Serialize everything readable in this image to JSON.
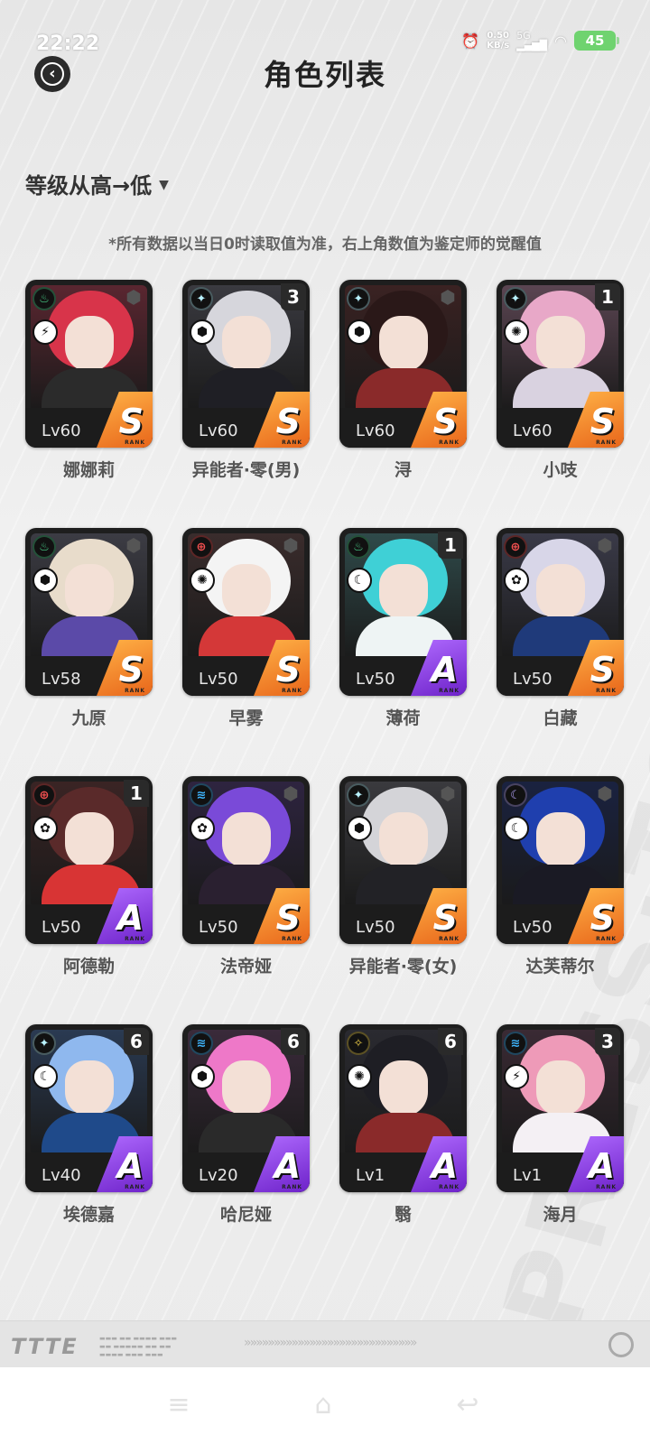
{
  "status_bar": {
    "time": "22:22",
    "net_speed_value": "0.50",
    "net_speed_unit": "KB/s",
    "network": "5G",
    "battery": "45"
  },
  "header": {
    "title": "角色列表"
  },
  "sort": {
    "label": "等级从高→低"
  },
  "notice": "*所有数据以当日0时读取值为准，右上角数值为鉴定师的觉醒值",
  "colors": {
    "rank_S": "#f07a22",
    "rank_A": "#8a3ee0",
    "card_bg": "#1e1e1e"
  },
  "characters": [
    {
      "name": "娜娜莉",
      "level": "Lv60",
      "rank": "S",
      "awakening": "",
      "element": "fire",
      "element_glyph": "♨",
      "element_color": "#4ad18a",
      "type_glyph": "⚡",
      "palette": [
        "#5a2630",
        "#d8344a",
        "#2b2b2b"
      ]
    },
    {
      "name": "异能者·零(男)",
      "level": "Lv60",
      "rank": "S",
      "awakening": "3",
      "element": "light",
      "element_glyph": "✦",
      "element_color": "#b9f2ff",
      "type_glyph": "⬢",
      "palette": [
        "#3a3a40",
        "#d6d6dc",
        "#1f1f25"
      ]
    },
    {
      "name": "浔",
      "level": "Lv60",
      "rank": "S",
      "awakening": "",
      "element": "light",
      "element_glyph": "✦",
      "element_color": "#b9f2ff",
      "type_glyph": "⬢",
      "palette": [
        "#3a2222",
        "#2a1818",
        "#8a2a2a"
      ]
    },
    {
      "name": "小吱",
      "level": "Lv60",
      "rank": "S",
      "awakening": "1",
      "element": "light",
      "element_glyph": "✦",
      "element_color": "#b9f2ff",
      "type_glyph": "✺",
      "palette": [
        "#5b4552",
        "#e8a8c8",
        "#d9d2e0"
      ]
    },
    {
      "name": "九原",
      "level": "Lv58",
      "rank": "S",
      "awakening": "",
      "element": "fire",
      "element_glyph": "♨",
      "element_color": "#4ad18a",
      "type_glyph": "⬢",
      "palette": [
        "#3c3c44",
        "#e8dccb",
        "#5b4aa8"
      ]
    },
    {
      "name": "早雾",
      "level": "Lv50",
      "rank": "S",
      "awakening": "",
      "element": "crit",
      "element_glyph": "⊕",
      "element_color": "#f25050",
      "type_glyph": "✺",
      "palette": [
        "#3a2c2c",
        "#f4f4f4",
        "#d43838"
      ]
    },
    {
      "name": "薄荷",
      "level": "Lv50",
      "rank": "A",
      "awakening": "1",
      "element": "fire",
      "element_glyph": "♨",
      "element_color": "#4ad18a",
      "type_glyph": "☾",
      "palette": [
        "#2f4a4a",
        "#3fd0d6",
        "#eef4f4"
      ]
    },
    {
      "name": "白藏",
      "level": "Lv50",
      "rank": "S",
      "awakening": "",
      "element": "crit",
      "element_glyph": "⊕",
      "element_color": "#f25050",
      "type_glyph": "✿",
      "palette": [
        "#3a3a48",
        "#d8d6e8",
        "#1f3a7a"
      ]
    },
    {
      "name": "阿德勒",
      "level": "Lv50",
      "rank": "A",
      "awakening": "1",
      "element": "crit",
      "element_glyph": "⊕",
      "element_color": "#f25050",
      "type_glyph": "✿",
      "palette": [
        "#3a2424",
        "#5a2a2a",
        "#d83434"
      ]
    },
    {
      "name": "法帝娅",
      "level": "Lv50",
      "rank": "S",
      "awakening": "",
      "element": "water",
      "element_glyph": "≋",
      "element_color": "#3fb6ff",
      "type_glyph": "✿",
      "palette": [
        "#2e2440",
        "#7a4ad8",
        "#2a2030"
      ]
    },
    {
      "name": "异能者·零(女)",
      "level": "Lv50",
      "rank": "S",
      "awakening": "",
      "element": "light",
      "element_glyph": "✦",
      "element_color": "#b9f2ff",
      "type_glyph": "⬢",
      "palette": [
        "#3a3a3e",
        "#d4d4d8",
        "#222226"
      ]
    },
    {
      "name": "达芙蒂尔",
      "level": "Lv50",
      "rank": "S",
      "awakening": "",
      "element": "moon",
      "element_glyph": "☾",
      "element_color": "#b8a8ff",
      "type_glyph": "☾",
      "palette": [
        "#1a2240",
        "#1f3fae",
        "#1a1a24"
      ]
    },
    {
      "name": "埃德嘉",
      "level": "Lv40",
      "rank": "A",
      "awakening": "6",
      "element": "light",
      "element_glyph": "✦",
      "element_color": "#b9f2ff",
      "type_glyph": "☾",
      "palette": [
        "#2a3a52",
        "#8fb8ee",
        "#1f4a8a"
      ]
    },
    {
      "name": "哈尼娅",
      "level": "Lv20",
      "rank": "A",
      "awakening": "6",
      "element": "water",
      "element_glyph": "≋",
      "element_color": "#3fb6ff",
      "type_glyph": "⬢",
      "palette": [
        "#3a2a3a",
        "#ee78c8",
        "#2a2a2a"
      ]
    },
    {
      "name": "翳",
      "level": "Lv1",
      "rank": "A",
      "awakening": "6",
      "element": "shuriken",
      "element_glyph": "✧",
      "element_color": "#f2d24a",
      "type_glyph": "✺",
      "palette": [
        "#2a2a30",
        "#1e1e24",
        "#8a2a2a"
      ]
    },
    {
      "name": "海月",
      "level": "Lv1",
      "rank": "A",
      "awakening": "3",
      "element": "water",
      "element_glyph": "≋",
      "element_color": "#3fb6ff",
      "type_glyph": "⚡",
      "palette": [
        "#3a2a34",
        "#ee9ab8",
        "#f4f0f4"
      ]
    }
  ],
  "rank_sub": "RANK",
  "footer": {
    "logo": "TTTE"
  },
  "icons": {
    "back": "chevron-left-circle-icon",
    "alarm": "alarm-icon",
    "wifi": "wifi-icon",
    "signal": "signal-icon"
  }
}
